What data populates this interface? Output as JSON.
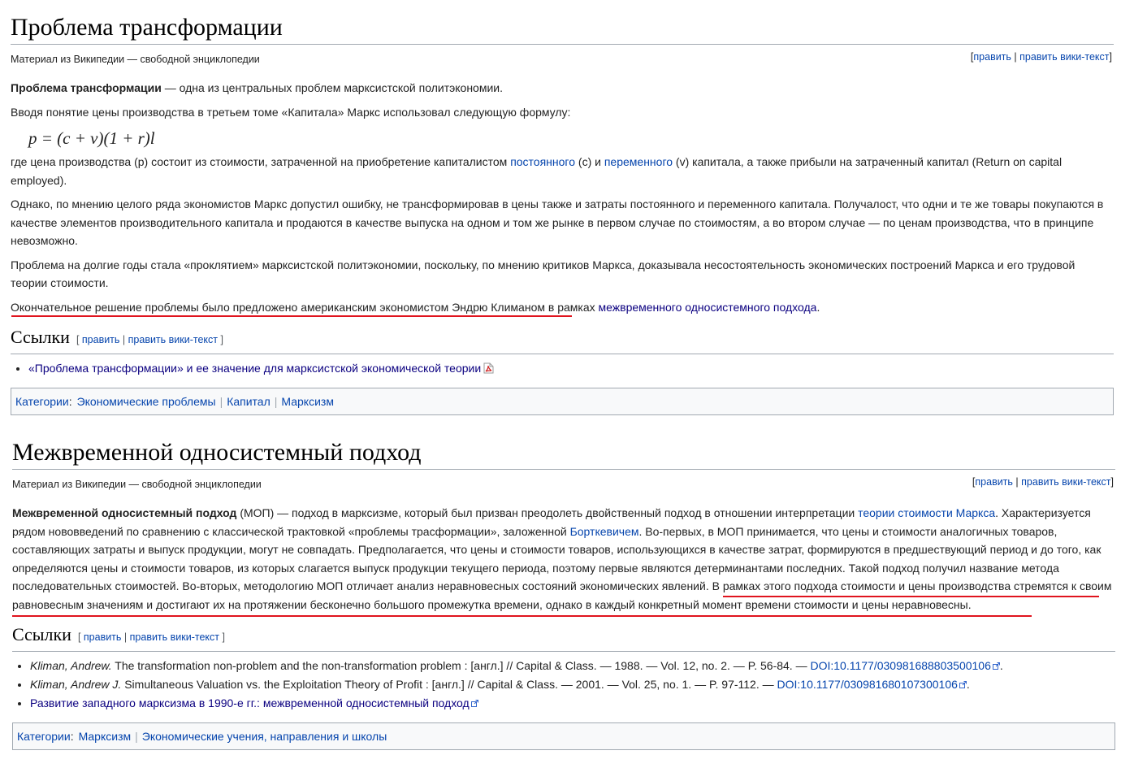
{
  "article1": {
    "title": "Проблема трансформации",
    "tagline": "Материал из Википедии — свободной энциклопедии",
    "edit": "править",
    "edit_wiki": "править вики-текст",
    "intro_bold": "Проблема трансформации",
    "intro_rest": " — одна из центральных проблем марксистской политэкономии.",
    "p2": "Вводя понятие цены производства в третьем томе «Капитала» Маркс использовал следующую формулу:",
    "formula": "p = (c + v)(1 + r)l",
    "p3_a": "где цена производства (p) состоит из стоимости, затраченной на приобретение капиталистом ",
    "p3_link1": "постоянного",
    "p3_b": " (c) и ",
    "p3_link2": "переменного",
    "p3_c": " (v) капитала, а также прибыли на затраченный капитал (Return on capital employed).",
    "p4": "Однако, по мнению целого ряда экономистов Маркс допустил ошибку, не трансформировав в цены также и затраты постоянного и переменного капитала. Получалост, что одни и те же товары покупаются в качестве элементов производительного капитала и продаются в качестве выпуска на одном и том же рынке в первом случае по стоимостям, а во втором случае — по ценам производства, что в принципе невозможно.",
    "p5": "Проблема на долгие годы стала «проклятием» марксистской политэкономии, поскольку, по мнению критиков Маркса, доказывала несостоятельность экономических построений Маркса и его трудовой теории стоимости.",
    "p6_a": "Окончательное решение проблемы было предложено американским экономистом Эндрю Климаном в рамках ",
    "p6_link": "межвременного односистемного подхода",
    "p6_end": ".",
    "links_heading": "Ссылки",
    "ref1": "«Проблема трансформации» и ее значение для марксистской экономической теории",
    "categories_label": "Категории",
    "categories": [
      "Экономические проблемы",
      "Капитал",
      "Марксизм"
    ]
  },
  "article2": {
    "title": "Межвременной односистемный подход",
    "tagline": "Материал из Википедии — свободной энциклопедии",
    "edit": "править",
    "edit_wiki": "править вики-текст",
    "intro_bold": "Межвременной односистемный подход",
    "t1": " (МОП) — подход в марксизме, который был призван преодолеть двойственный подход в отношении интерпретации ",
    "link1": "теории стоимости Маркса",
    "t2": ". Характеризуется рядом нововведений по сравнению с классической трактовкой «проблемы трасформации», заложенной ",
    "link2": "Борткевичем",
    "t3": ". Во-первых, в МОП принимается, что цены и стоимости аналогичных товаров, составляющих затраты и выпуск продукции, могут не совпадать. Предполагается, что цены и стоимости товаров, использующихся в качестве затрат, формируются в предшествующий период и до того, как определяются цены и стоимости товаров, из которых слагается выпуск продукции текущего периода, поэтому первые являются детерминантами последних. Такой подход получил название метода последовательных стоимостей. Во-вторых, методологию МОП отличает анализ неравновесных состояний экономических явлений. ",
    "t4": "В рамках этого подхода стоимости и цены производства стремятся к своим равновесным значениям и достигают их на протяжении бесконечно большого промежутка времени, однако в каждый конкретный момент времени стоимости и цены неравновесны.",
    "links_heading": "Ссылки",
    "refs": [
      {
        "author": "Kliman, Andrew.",
        "text": " The transformation non-problem and the non-transformation problem : [англ.] // Capital & Class. — 1988. — Vol. 12, no. 2. — P. 56-84. — ",
        "doi": "DOI:10.1177/030981688803500106",
        "end": "."
      },
      {
        "author": "Kliman, Andrew J.",
        "text": " Simultaneous Valuation vs. the Exploitation Theory of Profit : [англ.] // Capital & Class. — 2001. — Vol. 25, no. 1. — P. 97-112. — ",
        "doi": "DOI:10.1177/030981680107300106",
        "end": "."
      }
    ],
    "ref3": "Развитие западного марксизма в 1990-е гг.: межвременной односистемный подход",
    "categories_label": "Категории",
    "categories": [
      "Марксизм",
      "Экономические учения, направления и школы"
    ]
  },
  "colors": {
    "link": "#0645ad",
    "visited": "#0b0080",
    "underline_annotation": "#e0141e",
    "border": "#a2a9b1"
  }
}
